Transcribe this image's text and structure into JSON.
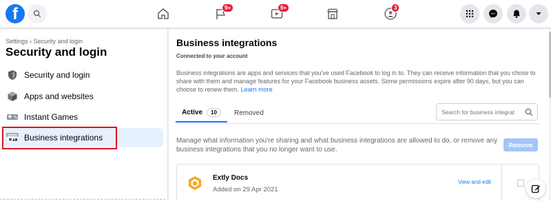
{
  "topbar": {
    "logo_text": "f",
    "notifications": {
      "flag_badge": "9+",
      "video_badge": "9+",
      "groups_badge": "3"
    }
  },
  "sidebar": {
    "breadcrumb": "Settings › Security and login",
    "title": "Security and login",
    "items": [
      {
        "label": "Security and login",
        "icon": "shield-icon"
      },
      {
        "label": "Apps and websites",
        "icon": "cube-icon"
      },
      {
        "label": "Instant Games",
        "icon": "gamepad-icon"
      },
      {
        "label": "Business integrations",
        "icon": "briefcase-icon",
        "active": true
      }
    ]
  },
  "main": {
    "title": "Business integrations",
    "subtitle": "Connected to your account",
    "description": "Business integrations are apps and services that you've used Facebook to log in to. They can receive information that you chose to share with them and manage features for your Facebook business assets. Some permissions expire after 90 days, but you can choose to renew them.",
    "learn_more": "Learn more",
    "tabs": {
      "active_label": "Active",
      "active_count": "10",
      "removed_label": "Removed"
    },
    "search_placeholder": "Search for business integrat",
    "manage_text": "Manage what information you're sharing and what business integrations are allowed to do, or remove any business integrations that you no longer want to use.",
    "remove_label": "Remove",
    "integrations": [
      {
        "name": "Extly Docs",
        "date": "Added on 29 Apr 2021",
        "action": "View and edit"
      }
    ]
  },
  "colors": {
    "brand": "#1877f2",
    "badge": "#e41e3f",
    "highlight_box": "#e0101a"
  }
}
